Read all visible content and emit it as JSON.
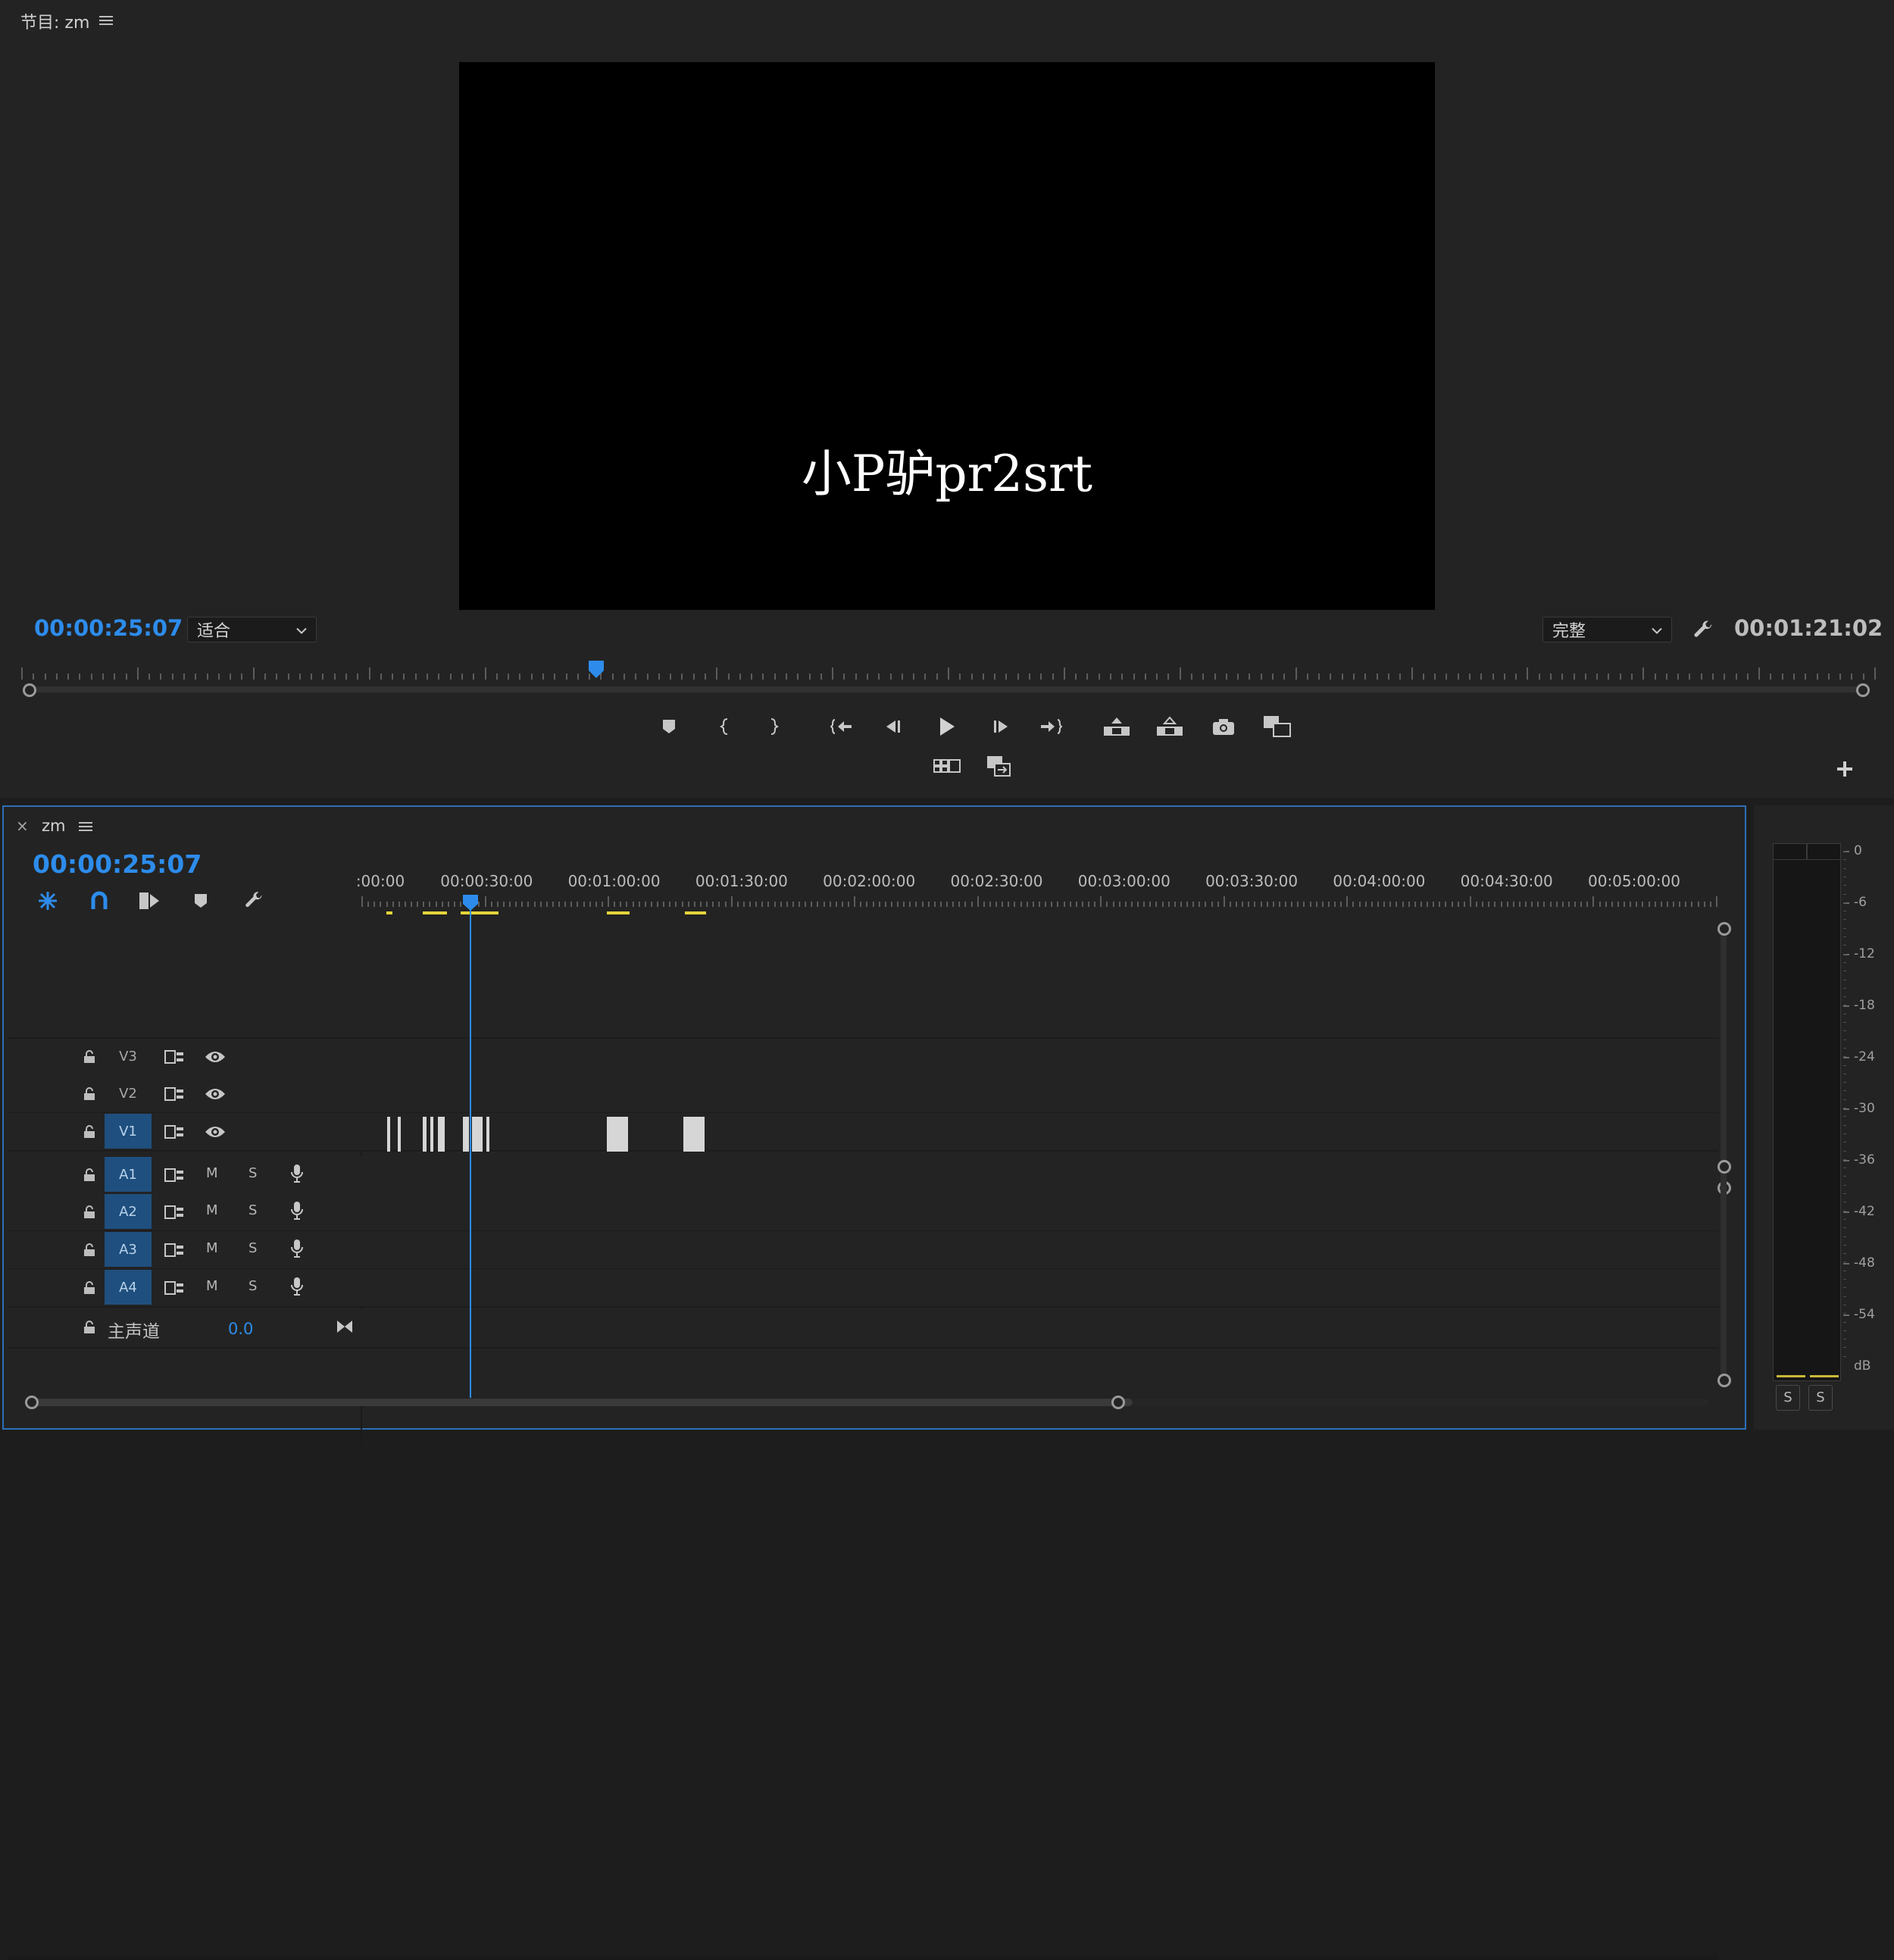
{
  "program_monitor": {
    "title": "节目: zm",
    "overlay_text": "小P驴pr2srt",
    "current_time": "00:00:25:07",
    "fit_label": "适合",
    "quality_label": "完整",
    "duration": "00:01:21:02",
    "playhead_fraction": 0.31
  },
  "timeline": {
    "sequence_name": "zm",
    "close_glyph": "×",
    "current_time": "00:00:25:07",
    "ruler_labels": [
      ":00:00",
      "00:00:30:00",
      "00:01:00:00",
      "00:01:30:00",
      "00:02:00:00",
      "00:02:30:00",
      "00:03:00:00",
      "00:03:30:00",
      "00:04:00:00",
      "00:04:30:00",
      "00:05:00:00"
    ],
    "video_tracks": [
      {
        "name": "V3",
        "active": false
      },
      {
        "name": "V2",
        "active": false
      },
      {
        "name": "V1",
        "active": true
      }
    ],
    "audio_tracks": [
      {
        "name": "A1",
        "m": "M",
        "s": "S"
      },
      {
        "name": "A2",
        "m": "M",
        "s": "S"
      },
      {
        "name": "A3",
        "m": "M",
        "s": "S"
      },
      {
        "name": "A4",
        "m": "M",
        "s": "S"
      }
    ],
    "master": {
      "label": "主声道",
      "value": "0.0"
    }
  },
  "audio_meter": {
    "scale": [
      "0",
      "-6",
      "-12",
      "-18",
      "-24",
      "-30",
      "-36",
      "-42",
      "-48",
      "-54",
      "dB"
    ],
    "solo_left": "S",
    "solo_right": "S"
  },
  "colors": {
    "accent": "#2d8ceb",
    "clip": "#d6d6d6",
    "marker": "#e5d43a"
  }
}
